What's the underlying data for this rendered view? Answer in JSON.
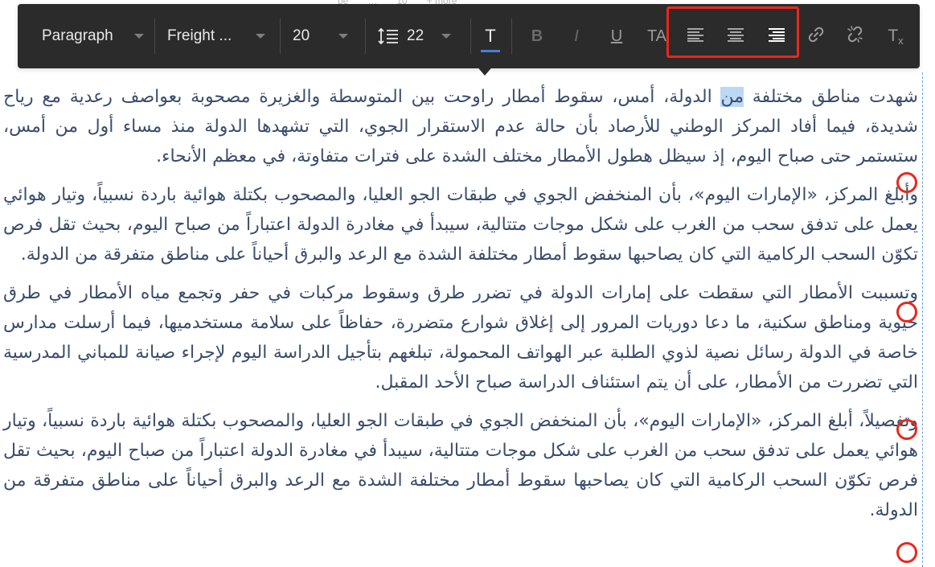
{
  "top_ghost": {
    "items": [
      "be",
      "…",
      "10",
      "+ more"
    ]
  },
  "toolbar": {
    "paragraph_style": "Paragraph",
    "font_family": "Freight ...",
    "font_size": "20",
    "line_height": "22",
    "text_button_label": "T",
    "bold_label": "B",
    "italic_label": "I",
    "underline_label": "U",
    "caps_label": "TA",
    "clear_format_label": "T",
    "clear_format_sub": "x"
  },
  "content": {
    "para1_before": "شهدت مناطق مختلفة ",
    "para1_highlight": "من",
    "para1_after": " الدولة، أمس، سقوط أمطار راوحت بين المتوسطة والغزيرة مصحوبة بعواصف رعدية مع رياح شديدة، فيما أفاد المركز الوطني للأرصاد بأن حالة عدم الاستقرار الجوي، التي تشهدها الدولة منذ مساء أول من أمس، ستستمر حتى صباح اليوم، إذ سيظل هطول الأمطار مختلف الشدة على فترات متفاوتة، في معظم الأنحاء.",
    "para2": "وأبلغ المركز، «الإمارات اليوم»، بأن المنخفض الجوي في طبقات الجو العليا، والمصحوب بكتلة هوائية باردة نسبياً، وتيار هوائي يعمل على تدفق سحب من الغرب على شكل موجات متتالية، سيبدأ في مغادرة الدولة اعتباراً من صباح اليوم، بحيث تقل فرص تكوّن السحب الركامية التي كان يصاحبها سقوط أمطار مختلفة الشدة مع الرعد والبرق أحياناً على مناطق متفرقة من الدولة.",
    "para3": "وتسببت الأمطار التي سقطت على إمارات الدولة في تضرر طرق وسقوط مركبات في حفر وتجمع مياه الأمطار في طرق حيوية ومناطق سكنية، ما دعا دوريات المرور إلى إغلاق شوارع متضررة، حفاظاً على سلامة مستخدميها، فيما أرسلت مدارس خاصة في الدولة رسائل نصية لذوي الطلبة عبر الهواتف المحمولة، تبلغهم بتأجيل الدراسة اليوم لإجراء صيانة للمباني المدرسية التي تضررت من الأمطار، على أن يتم استئناف الدراسة صباح الأحد المقبل.",
    "para4": "وتفصيلاً، أبلغ المركز، «الإمارات اليوم»، بأن المنخفض الجوي في طبقات الجو العليا، والمصحوب بكتلة هوائية باردة نسبياً، وتيار هوائي يعمل على تدفق سحب من الغرب على شكل موجات متتالية، سيبدأ في مغادرة الدولة اعتباراً من صباح اليوم، بحيث تقل فرص تكوّن السحب الركامية التي كان يصاحبها سقوط أمطار مختلفة الشدة مع الرعد والبرق أحياناً على مناطق متفرقة من الدولة."
  },
  "colors": {
    "toolbar_bg": "#2b2b2b",
    "text": "#3a4d6b",
    "highlight": "#bcd9f3",
    "annotation_red": "#e8281d",
    "active_underline": "#4a7fd2"
  },
  "icons": {
    "line_height": "line-height-icon",
    "align_left": "align-left-icon",
    "align_center": "align-center-icon",
    "align_right": "align-right-icon",
    "link": "link-icon",
    "unlink": "unlink-icon",
    "clear_format": "clear-format-icon"
  }
}
